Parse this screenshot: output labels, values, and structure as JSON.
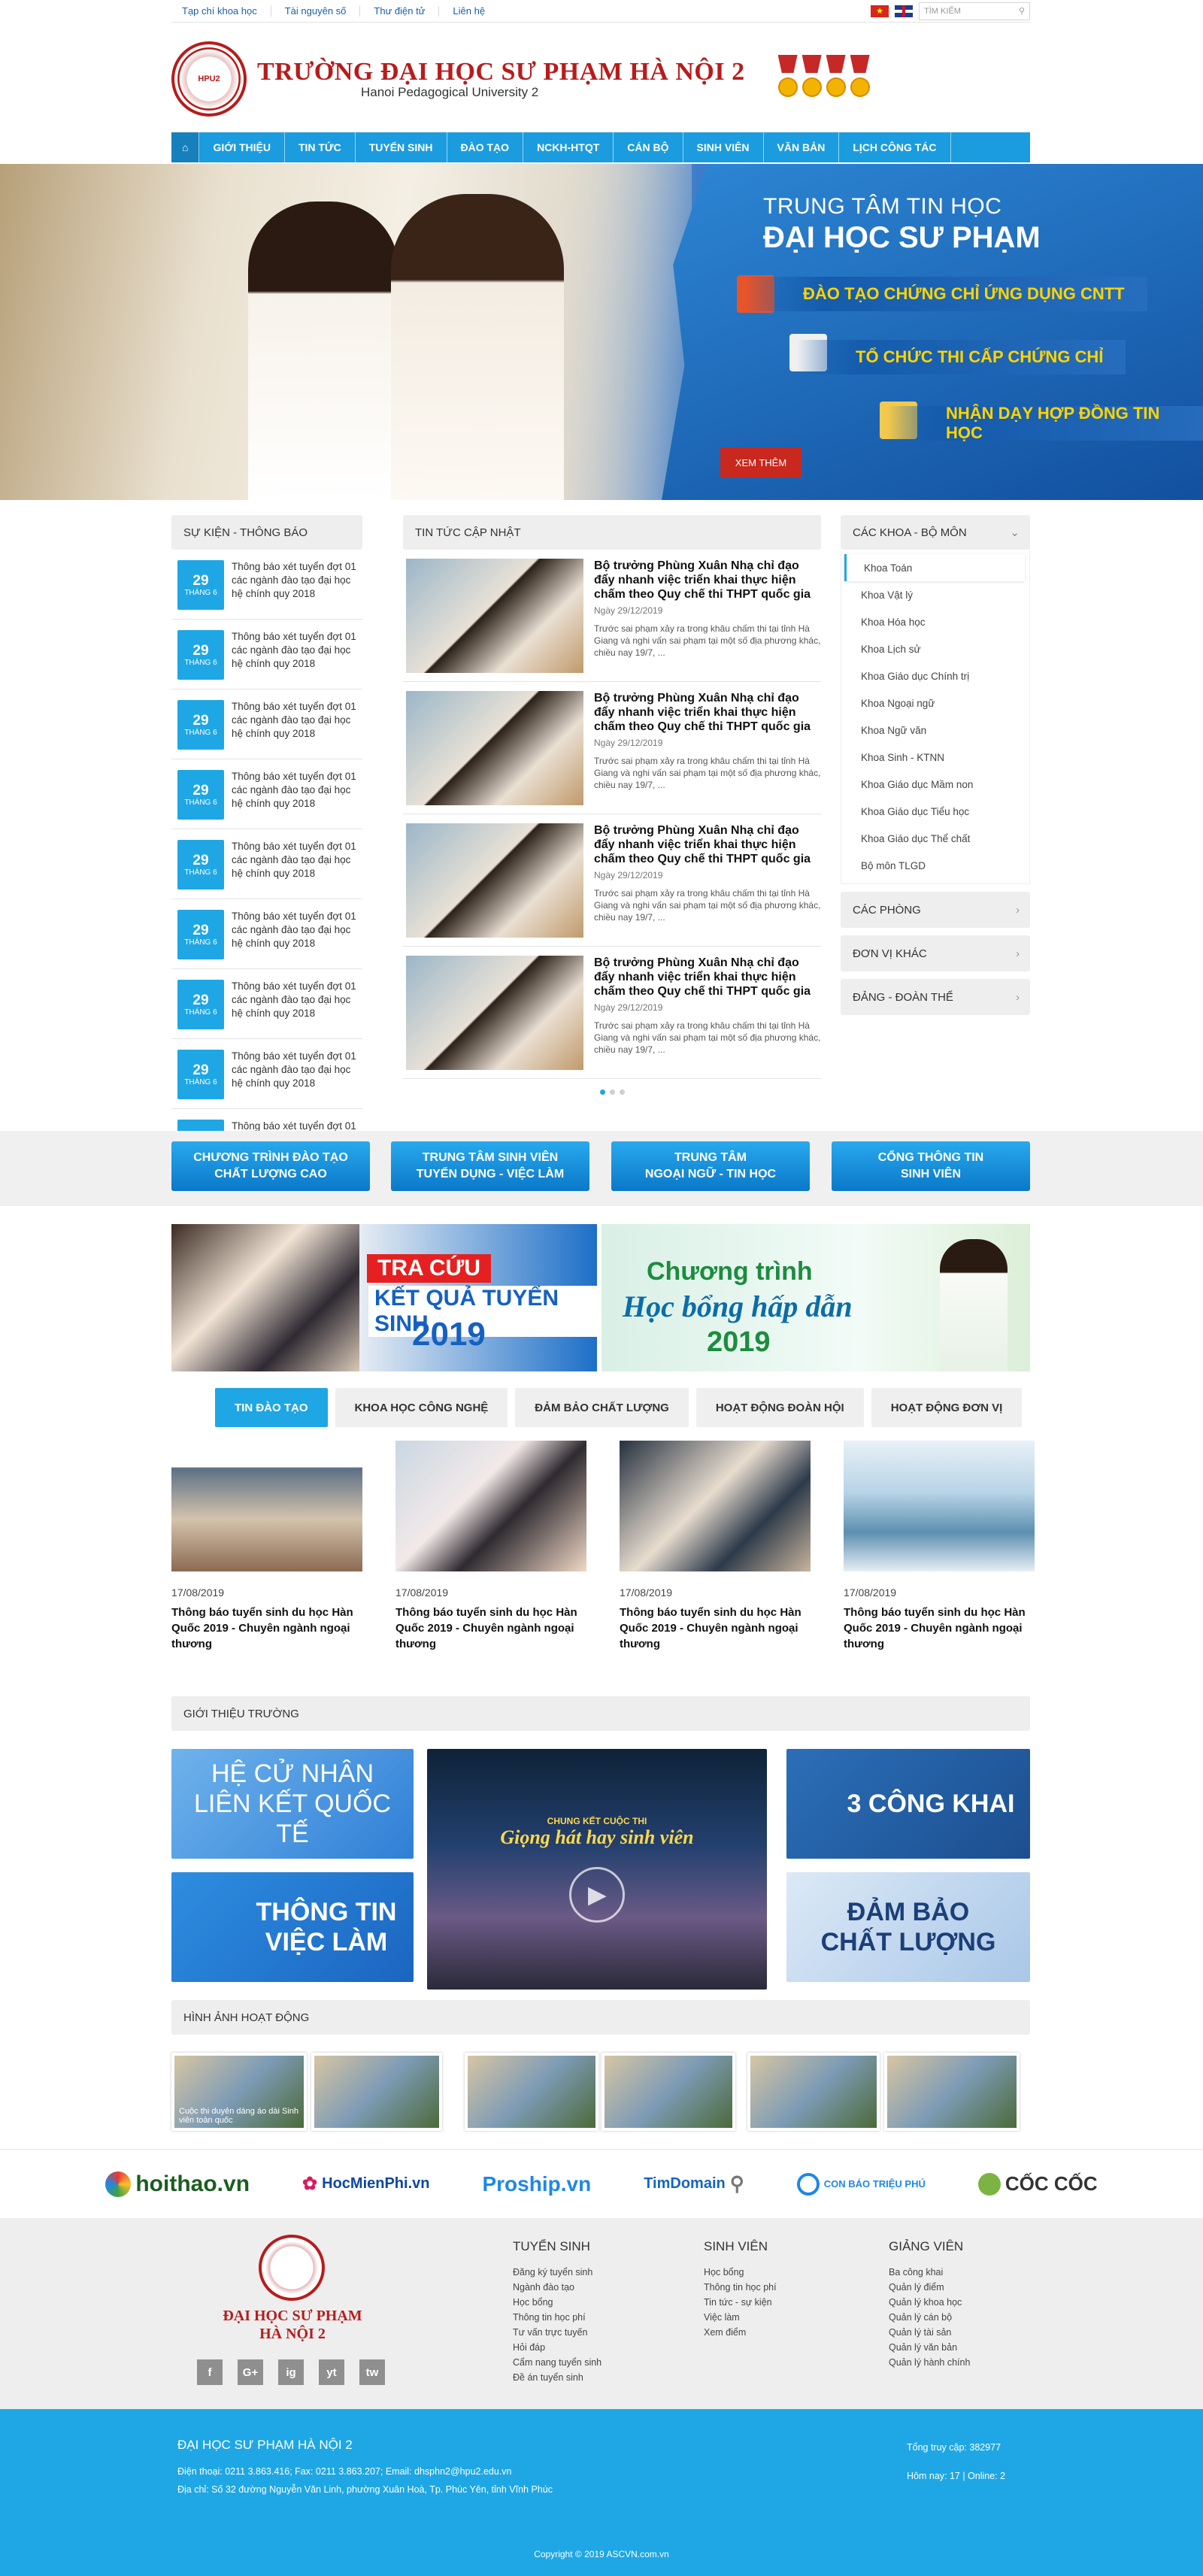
{
  "topbar": {
    "links": [
      "Tạp chí khoa học",
      "Tài nguyên số",
      "Thư điện tử",
      "Liên hệ"
    ],
    "search_placeholder": "TÌM KIẾM",
    "search_icon": "magnifier"
  },
  "header": {
    "title": "TRƯỜNG ĐẠI HỌC SƯ PHẠM HÀ NỘI 2",
    "subtitle": "Hanoi Pedagogical University 2",
    "logo_text": "HPU2"
  },
  "nav": {
    "items": [
      "GIỚI THIỆU",
      "TIN TỨC",
      "TUYỂN SINH",
      "ĐÀO TẠO",
      "NCKH-HTQT",
      "CÁN BỘ",
      "SINH VIÊN",
      "VĂN BẢN",
      "LỊCH CÔNG TÁC"
    ]
  },
  "banner": {
    "line1": "TRUNG TÂM TIN HỌC",
    "line2": "ĐẠI HỌC SƯ PHẠM",
    "items": [
      "ĐÀO TẠO CHỨNG CHỈ ỨNG DỤNG CNTT",
      "TỔ CHỨC THI CẤP CHỨNG CHỈ",
      "NHẬN DẠY HỢP ĐỒNG TIN HỌC"
    ],
    "button": "XEM THÊM"
  },
  "events": {
    "title": "SỰ KIỆN - THÔNG BÁO",
    "day": "29",
    "month": "THÁNG 6",
    "text": "Thông báo xét tuyển đợt 01 các ngành đào tạo đại học hệ chính quy 2018",
    "count": 9
  },
  "news": {
    "title": "TIN TỨC CẬP NHẬT",
    "item_title": "Bộ trưởng Phùng Xuân Nhạ chỉ đạo đẩy nhanh việc triển khai thực hiện chấm theo Quy chế thi THPT quốc gia",
    "item_date": "Ngày 29/12/2019",
    "item_desc": "Trước sai phạm xảy ra trong khâu chấm thi tại tỉnh Hà Giang và nghi vấn sai phạm tại một số địa phương khác, chiều nay 19/7, ...",
    "count": 4
  },
  "faculties": {
    "title": "CÁC KHOA - BỘ MÔN",
    "items": [
      "Khoa Toán",
      "Khoa Vật lý",
      "Khoa Hóa học",
      "Khoa Lịch sử",
      "Khoa Giáo dục Chính trị",
      "Khoa Ngoại ngữ",
      "Khoa Ngữ văn",
      "Khoa Sinh - KTNN",
      "Khoa Giáo dục Mầm non",
      "Khoa Giáo dục Tiểu học",
      "Khoa Giáo dục Thể chất",
      "Bộ môn TLGD"
    ],
    "more": [
      "CÁC PHÒNG",
      "ĐƠN VỊ KHÁC",
      "ĐẢNG - ĐOÀN THỂ"
    ]
  },
  "quick_buttons": [
    [
      "CHƯƠNG TRÌNH ĐÀO TẠO",
      "CHẤT LƯỢNG CAO"
    ],
    [
      "TRUNG TÂM SINH VIÊN",
      "TUYỂN DỤNG - VIỆC LÀM"
    ],
    [
      "TRUNG TÂM",
      "NGOẠI NGỮ - TIN HỌC"
    ],
    [
      "CỔNG THÔNG TIN",
      "SINH VIÊN"
    ]
  ],
  "promo1": {
    "badge": "TRA CỨU",
    "line2": "KẾT QUẢ TUYỂN SINH",
    "year": "2019"
  },
  "promo2": {
    "line1": "Chương trình",
    "line2": "Học bổng hấp dẫn",
    "year": "2019"
  },
  "tabs": [
    "TIN ĐÀO TẠO",
    "KHOA HỌC CÔNG NGHỆ",
    "ĐẢM BẢO CHẤT LƯỢNG",
    "HOẠT ĐỘNG ĐOÀN HỘI",
    "HOẠT ĐỘNG ĐƠN VỊ"
  ],
  "cards": {
    "date": "17/08/2019",
    "title": "Thông báo tuyển sinh du học Hàn Quốc 2019 - Chuyên ngành ngoại thương",
    "count": 4
  },
  "intro": {
    "title": "GIỚI THIỆU TRƯỜNG",
    "tile1": "HỆ CỬ NHÂN LIÊN KẾT QUỐC TẾ",
    "tile2": "THÔNG TIN VIỆC LÀM",
    "tile3": "3 CÔNG KHAI",
    "tile4": "ĐẢM BẢO CHẤT LƯỢNG",
    "video_caption": "Giọng hát hay sinh viên",
    "video_header": "CHUNG KẾT CUỘC THI"
  },
  "gallery": {
    "title": "HÌNH ẢNH HOẠT ĐỘNG",
    "caption": "Cuộc thi duyên dáng áo dài Sinh viên toàn quốc"
  },
  "partners": [
    "hoithao.vn",
    "HocMienPhi.vn",
    "Proship.vn",
    "TimDomain",
    "CON BÁO TRIỆU PHÚ",
    "CỐC CỐC"
  ],
  "footer": {
    "name": "ĐẠI HỌC SƯ PHẠM HÀ NỘI 2",
    "social": [
      "f",
      "G+",
      "ig",
      "yt",
      "tw"
    ],
    "col1_title": "TUYỂN SINH",
    "col1": [
      "Đăng ký tuyển sinh",
      "Ngành đào tạo",
      "Học bổng",
      "Thông tin học phí",
      "Tư vấn trực tuyến",
      "Hỏi đáp",
      "Cẩm nang tuyển sinh",
      "Đề án tuyển sinh"
    ],
    "col2_title": "SINH VIÊN",
    "col2": [
      "Học bổng",
      "Thông tin học phí",
      "Tin tức - sự kiện",
      "Việc làm",
      "Xem điểm"
    ],
    "col3_title": "GIẢNG VIÊN",
    "col3": [
      "Ba công khai",
      "Quản lý điểm",
      "Quản lý khoa học",
      "Quản lý cán bộ",
      "Quản lý tài sản",
      "Quản lý văn bản",
      "Quản lý hành chính"
    ]
  },
  "bottom": {
    "title": "ĐẠI HỌC SƯ PHẠM HÀ NỘI 2",
    "contact": "Điện thoại: 0211 3.863.416;  Fax: 0211 3.863.207;  Email: dhsphn2@hpu2.edu.vn",
    "address": "Địa chỉ: Số 32 đường Nguyễn Văn Linh, phường Xuân Hoà, Tp. Phúc Yên, tỉnh Vĩnh Phúc",
    "total_visits": "Tổng truy cập:  382977",
    "today": "Hôm nay:   17     |   Online:   2",
    "copyright": "Copyright © 2019 ASCVN.com.vn"
  },
  "colors": {
    "primary": "#1ea7e4",
    "brand_red": "#b71c1c",
    "nav": "#1b9cdf"
  }
}
